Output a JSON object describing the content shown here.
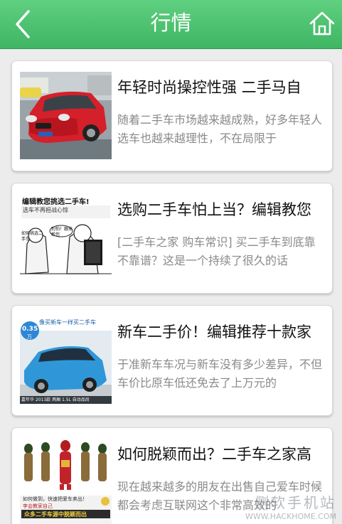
{
  "header": {
    "title": "行情",
    "back_icon": "back-chevron-icon",
    "home_icon": "home-icon"
  },
  "articles": [
    {
      "title": "年轻时尚操控性强 二手马自",
      "summary": "随着二手车市场越来越成熟，好多年轻人选车也越来越理性，不在局限于",
      "thumbnail": "red-sedan-photo"
    },
    {
      "title": "选购二手车怕上当？编辑教您",
      "summary": "[二手车之家 购车常识] 买二手车到底靠不靠谱？这是一个持续了很久的话",
      "thumbnail": "cartoon-illustration",
      "thumb_heading": "编辑教您挑选二手车!",
      "thumb_sub": "选车不再担战心惊",
      "thumb_bubble_1": "如何挑选二手车",
      "thumb_bubble_2": "别怕！跟来帮您"
    },
    {
      "title": "新车二手价！编辑推荐十款家",
      "summary": "于准新车车况与新车没有多少差异，不但车价比原车低还免去了上万元的",
      "thumbnail": "blue-hatchback-photo",
      "thumb_banner": "像买新车一样买二手车",
      "thumb_price": "0.35",
      "thumb_price_unit": "万",
      "thumb_caption": "嘉年华 2013款 两厢 1.5L 自动品尚"
    },
    {
      "title": "如何脱颖而出？二手车之家高",
      "summary": "现在越来越多的朋友在出售自己爱车时候都会考虑互联网这个非常高效的",
      "thumbnail": "ironman-figures-photo",
      "thumb_caption_1": "如何做到，快速把爱车卖出！",
      "thumb_caption_2": "李会教家自己",
      "thumb_caption_3": "众多二手车源中脱颖而出"
    }
  ],
  "watermark": {
    "cn": "侧软手机站",
    "en": "WWW.HACKHOME.COM"
  }
}
